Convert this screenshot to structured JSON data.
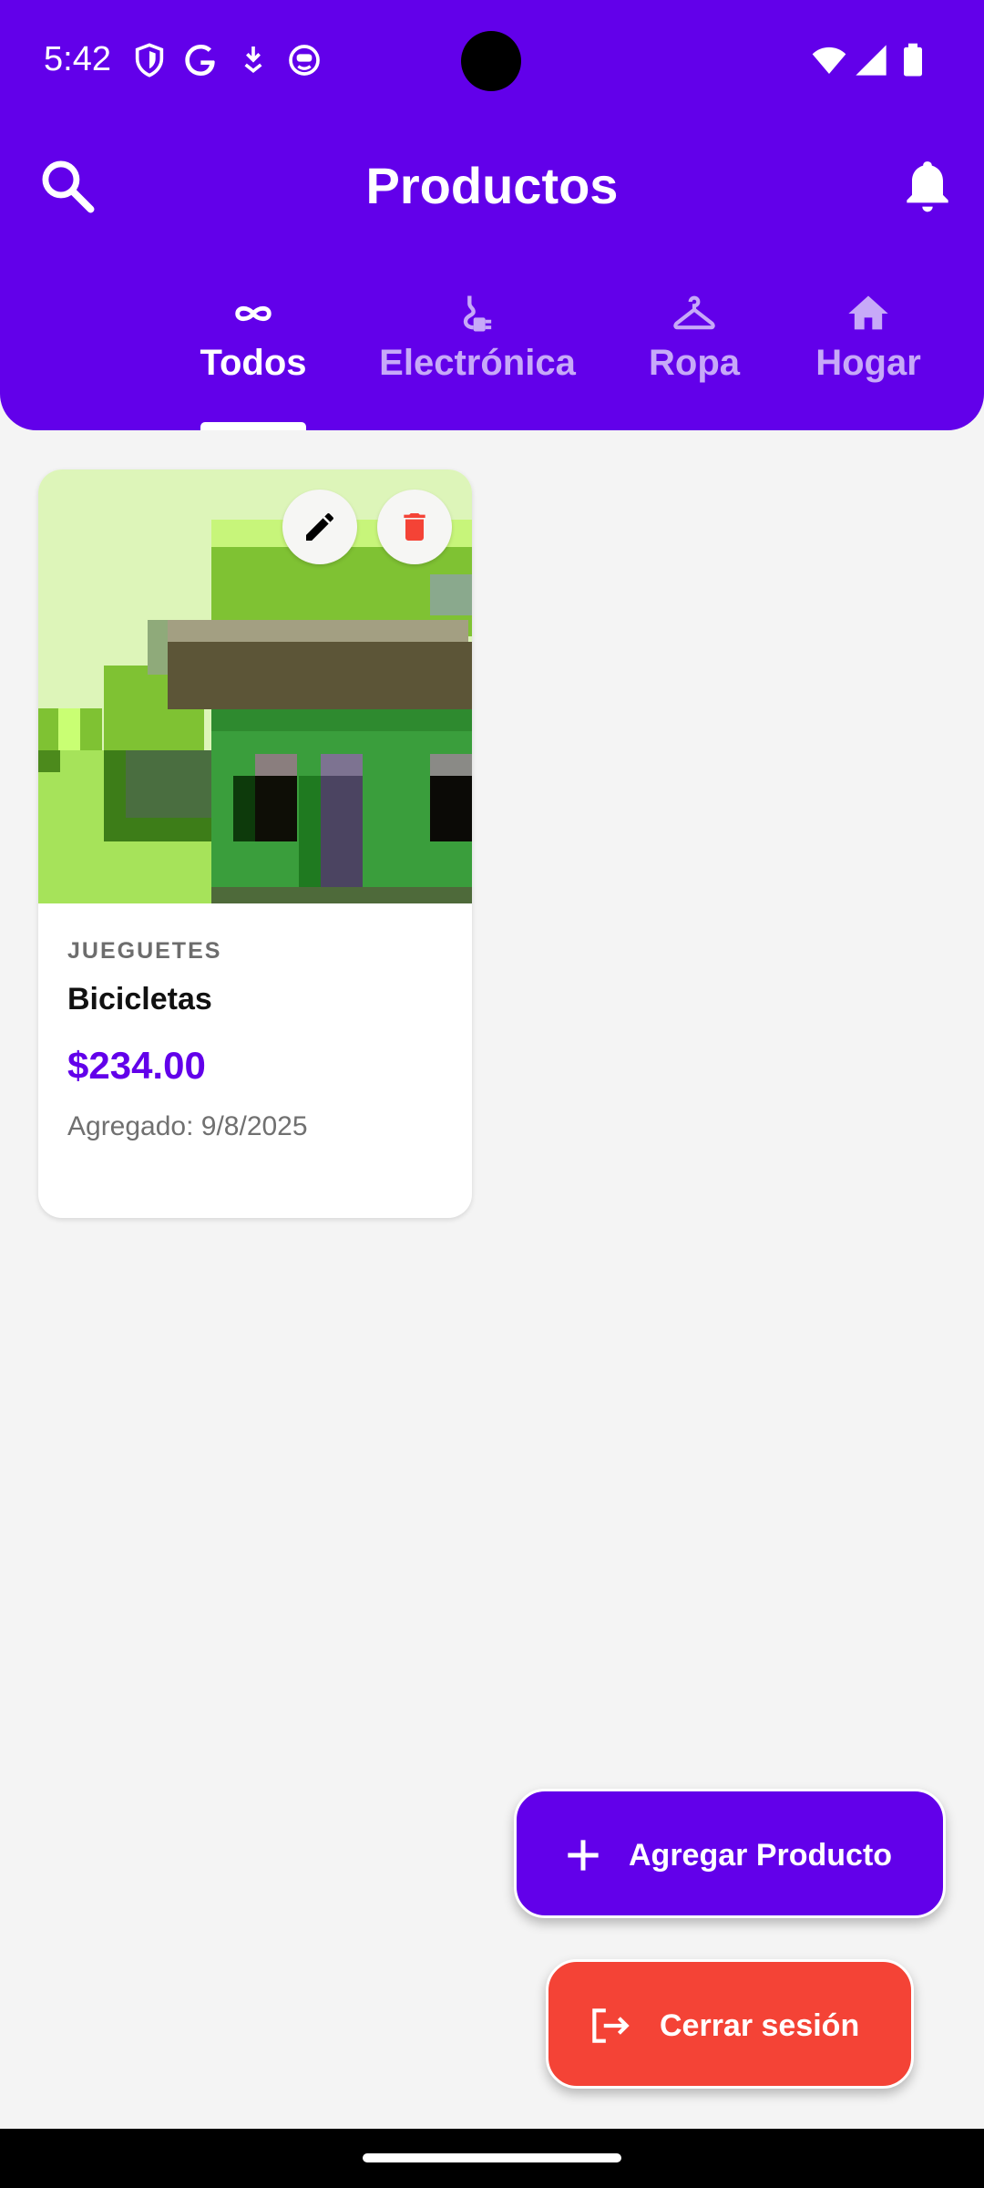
{
  "status_bar": {
    "time": "5:42",
    "left_icons": [
      "shield-icon",
      "google-icon",
      "download-arrow-icon",
      "emoji-face-icon"
    ],
    "right_icons": [
      "wifi-icon",
      "cellular-signal-icon",
      "battery-icon"
    ]
  },
  "app_bar": {
    "title": "Productos",
    "left_icon": "search-icon",
    "right_icon": "bell-icon",
    "background_color": "#6200ea"
  },
  "tabs": [
    {
      "label": "Todos",
      "icon": "infinity-icon",
      "active": true
    },
    {
      "label": "Electrónica",
      "icon": "power-plug-icon",
      "active": false
    },
    {
      "label": "Ropa",
      "icon": "hanger-icon",
      "active": false
    },
    {
      "label": "Hogar",
      "icon": "home-icon",
      "active": false
    }
  ],
  "products": [
    {
      "category": "JUEGUETES",
      "name": "Bicicletas",
      "price": "$234.00",
      "added": "Agregado: 9/8/2025",
      "image": "pixel-art-house-image",
      "actions": [
        "edit-icon",
        "delete-icon"
      ]
    }
  ],
  "fabs": {
    "add_label": "Agregar Producto",
    "add_icon": "plus-icon",
    "logout_label": "Cerrar sesión",
    "logout_icon": "logout-icon"
  },
  "colors": {
    "primary": "#6200ea",
    "danger": "#f44336",
    "background": "#f4f4f4",
    "inactive_tab": "#c7a9f8"
  }
}
